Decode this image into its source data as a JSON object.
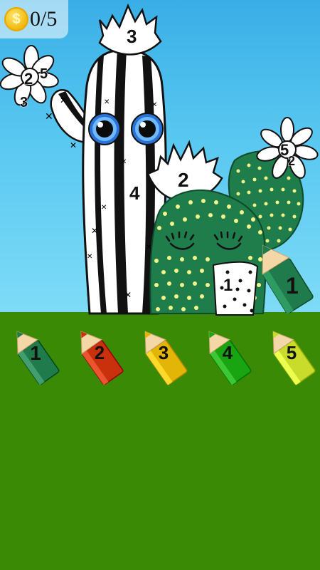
{
  "hud": {
    "coin_icon": "dollar-coin-icon",
    "coin_glyph": "$",
    "coin_count": "0/5"
  },
  "canvas": {
    "region_labels": {
      "tall_top_flower": "3",
      "tall_body": "4",
      "left_flower": "2",
      "left_flower_b": "5",
      "left_flower_c": "3",
      "middle_flower": "2",
      "right_flower": "5",
      "right_flower_b": "2",
      "pot": "1"
    }
  },
  "selected_pencil": {
    "label": "1",
    "color": "#1f7a4c"
  },
  "palette": [
    {
      "label": "1",
      "color": "#1f7a4c"
    },
    {
      "label": "2",
      "color": "#c8310b"
    },
    {
      "label": "3",
      "color": "#e3b507"
    },
    {
      "label": "4",
      "color": "#19a412"
    },
    {
      "label": "5",
      "color": "#c9dc2c"
    }
  ]
}
